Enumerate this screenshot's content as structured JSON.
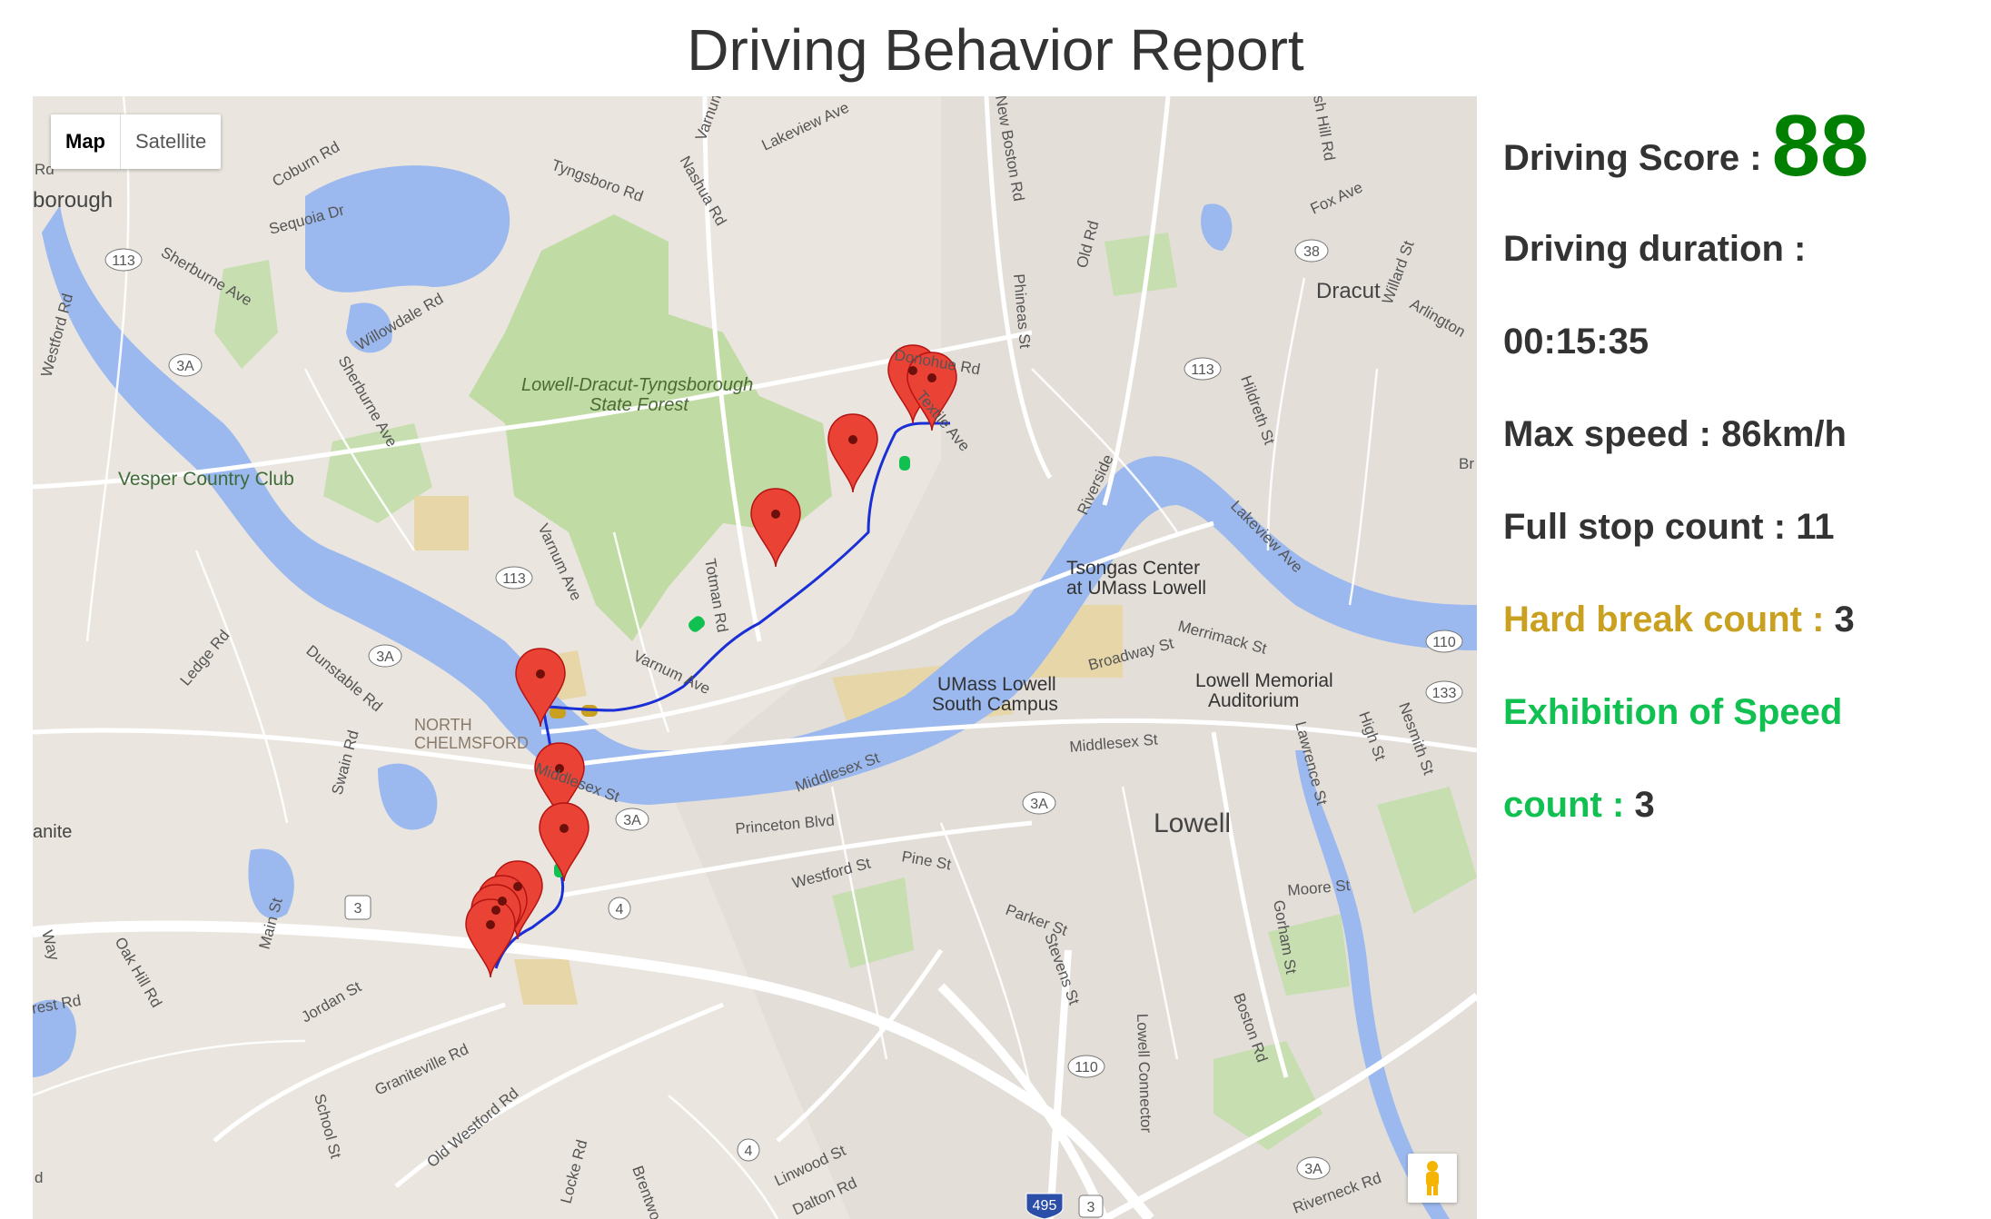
{
  "page": {
    "title": "Driving Behavior Report"
  },
  "map": {
    "type_control": {
      "map_label": "Map",
      "satellite_label": "Satellite"
    },
    "labels": {
      "forest": [
        "Lowell-Dracut-Tyngsborough",
        "State Forest"
      ],
      "vesper": "Vesper Country Club",
      "dracut": "Dracut",
      "lowell": "Lowell",
      "north_chelmsford": [
        "NORTH",
        "CHELMSFORD"
      ],
      "tsongas": [
        "Tsongas Center",
        "at UMass Lowell"
      ],
      "umass_south": [
        "UMass Lowell",
        "South Campus"
      ],
      "memorial": [
        "Lowell Memorial",
        "Auditorium"
      ],
      "borough": "borough",
      "granite": "anite",
      "streets": {
        "coburn": "Coburn Rd",
        "sequoia": "Sequoia Dr",
        "sherburne": "Sherburne Ave",
        "tyngsboro": "Tyngsboro Rd",
        "lakeview_top": "Lakeview Ave",
        "nashua": "Nashua Rd",
        "varnum_top": "Varnum",
        "new_boston": "New Boston Rd",
        "phineas": "Phineas St",
        "old_rd": "Old Rd",
        "hill_rd": "sh Hill Rd",
        "fox": "Fox Ave",
        "arlington": "Arlington",
        "willard": "Willard St",
        "hildreth": "Hildreth St",
        "donohue": "Donohue Rd",
        "textile": "Textile Ave",
        "willowdale": "Willowdale Rd",
        "sherburne2": "Sherburne Ave",
        "westford": "Westford Rd",
        "varnum_ave": "Varnum Ave",
        "totman": "Totman Rd",
        "varnum_ave2": "Varnum Ave",
        "riverside": "Riverside",
        "lakeview2": "Lakeview Ave",
        "merrimack": "Merrimack St",
        "broadway": "Broadway St",
        "middlesex1": "Middlesex St",
        "middlesex2": "Middlesex St",
        "middlesex3": "Middlesex St",
        "ledge": "Ledge Rd",
        "dunstable": "Dunstable Rd",
        "swain": "Swain Rd",
        "princeton": "Princeton Blvd",
        "westford_st": "Westford St",
        "pine": "Pine St",
        "parker": "Parker St",
        "stevens": "Stevens St",
        "lawrence": "Lawrence St",
        "high": "High St",
        "nesmith": "Nesmith St",
        "moore": "Moore St",
        "gorham": "Gorham St",
        "boston": "Boston Rd",
        "lowell_conn": "Lowell Connector",
        "main": "Main St",
        "oak_hill": "Oak Hill Rd",
        "jordan": "Jordan St",
        "graniteville": "Graniteville Rd",
        "school": "School St",
        "old_westford": "Old Westford Rd",
        "locke": "Locke Rd",
        "linwood": "Linwood St",
        "dalton": "Dalton Rd",
        "brentwood": "Brentwo",
        "riverneck": "Riverneck Rd",
        "way": "Way",
        "rd": "Rd",
        "forest_rd": "rest Rd",
        "edge_d": "d",
        "edge_b": "Br"
      },
      "shields": {
        "s113a": "113",
        "s3a_a": "3A",
        "s113b": "113",
        "s113c": "113",
        "s38": "38",
        "s3a_b": "3A",
        "s3a_c": "3A",
        "s3a_d": "3A",
        "s110a": "110",
        "s133": "133",
        "s3": "3",
        "s4a": "4",
        "s4b": "4",
        "s110b": "110",
        "s495": "495",
        "s3b": "3",
        "s3a_e": "3A"
      }
    }
  },
  "stats": {
    "driving_score_label": "Driving Score :",
    "driving_score_value": "88",
    "duration_label": "Driving duration :",
    "duration_value": "00:15:35",
    "max_speed_label": "Max speed :",
    "max_speed_value": "86km/h",
    "full_stop_label": "Full stop count :",
    "full_stop_value": "11",
    "hard_break_label": "Hard break count :",
    "hard_break_value": "3",
    "exhibition_label_1": "Exhibition of Speed",
    "exhibition_label_2": "count :",
    "exhibition_value": "3"
  },
  "colors": {
    "score": "#008000",
    "hard_break": "#c9a020",
    "exhibition": "#10c050",
    "route": "#1a2fd6",
    "river": "#9bb9ef",
    "forest": "#b9d89a",
    "marker": "#ea4335"
  }
}
